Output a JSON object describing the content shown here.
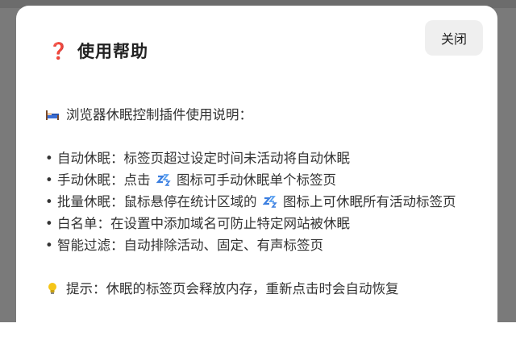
{
  "dialog": {
    "title_icon": "❓",
    "title": "使用帮助",
    "close_label": "关闭"
  },
  "content": {
    "intro_icon": "bed-icon",
    "intro": "浏览器休眠控制插件使用说明：",
    "items": [
      {
        "prefix": "• 自动休眠：标签页超过设定时间未活动将自动休眠"
      },
      {
        "prefix": "• 手动休眠：点击 ",
        "icon": "zzz-icon",
        "suffix": " 图标可手动休眠单个标签页"
      },
      {
        "prefix": "• 批量休眠：鼠标悬停在统计区域的 ",
        "icon": "zzz-icon",
        "suffix": " 图标上可休眠所有活动标签页"
      },
      {
        "prefix": "• 白名单：在设置中添加域名可防止特定网站被休眠"
      },
      {
        "prefix": "• 智能过滤：自动排除活动、固定、有声标签页"
      }
    ],
    "tip_icon": "lightbulb-icon",
    "tip": "提示：休眠的标签页会释放内存，重新点击时会自动恢复"
  },
  "colors": {
    "backdrop": "#7a7a7a",
    "dialog_bg": "#ffffff",
    "close_bg": "#efefef",
    "title_icon": "#d6336c"
  }
}
